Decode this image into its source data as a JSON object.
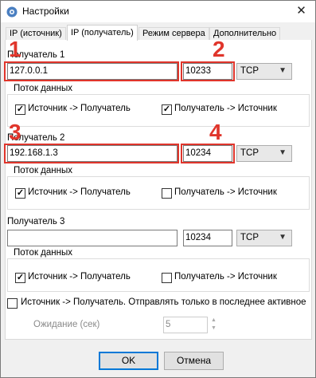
{
  "window": {
    "title": "Настройки",
    "close_glyph": "✕"
  },
  "tabs": [
    {
      "label": "IP (источник)",
      "active": false
    },
    {
      "label": "IP (получатель)",
      "active": true
    },
    {
      "label": "Режим сервера",
      "active": false
    },
    {
      "label": "Дополнительно",
      "active": false
    }
  ],
  "receivers": [
    {
      "label": "Получатель 1",
      "address": "127.0.0.1",
      "port": "10233",
      "protocol": "TCP",
      "flow_label": "Поток данных",
      "src_to_dst": {
        "label": "Источник -> Получатель",
        "checked": true
      },
      "dst_to_src": {
        "label": "Получатель -> Источник",
        "checked": true
      }
    },
    {
      "label": "Получатель 2",
      "address": "192.168.1.3",
      "port": "10234",
      "protocol": "TCP",
      "flow_label": "Поток данных",
      "src_to_dst": {
        "label": "Источник -> Получатель",
        "checked": true
      },
      "dst_to_src": {
        "label": "Получатель -> Источник",
        "checked": false
      }
    },
    {
      "label": "Получатель 3",
      "address": "",
      "port": "10234",
      "protocol": "TCP",
      "flow_label": "Поток данных",
      "src_to_dst": {
        "label": "Источник -> Получатель",
        "checked": true
      },
      "dst_to_src": {
        "label": "Получатель -> Источник",
        "checked": false
      }
    }
  ],
  "last_active": {
    "label": "Источник -> Получатель. Отправлять только в последнее активное соед",
    "checked": false
  },
  "wait": {
    "label": "Ожидание (сек)",
    "value": "5"
  },
  "annotations": [
    "1",
    "2",
    "3",
    "4"
  ],
  "buttons": {
    "ok": "OK",
    "cancel": "Отмена"
  },
  "colors": {
    "highlight": "#e0352b",
    "focus": "#0078d7"
  }
}
